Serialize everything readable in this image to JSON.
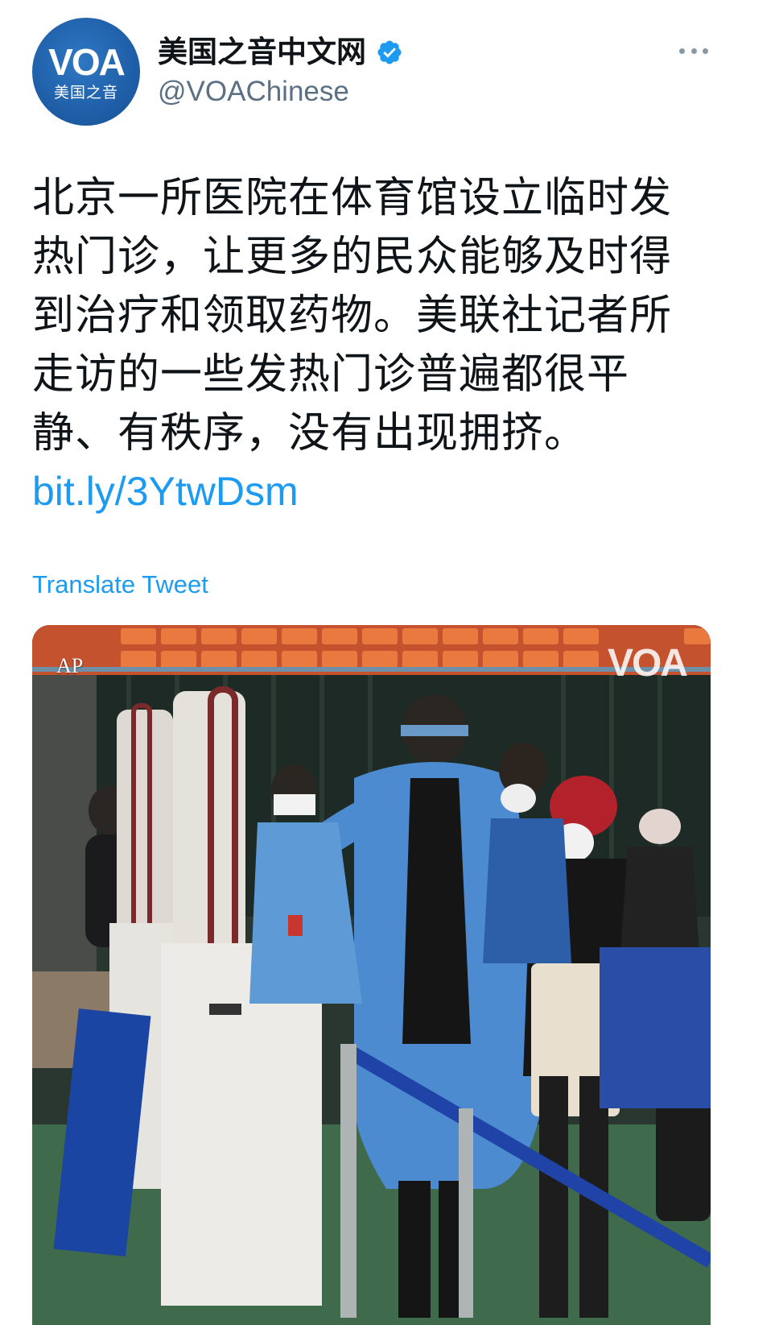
{
  "account": {
    "display_name": "美国之音中文网",
    "handle": "@VOAChinese",
    "avatar_logo": "VOA",
    "avatar_subtitle": "美国之音",
    "verified": true,
    "verified_icon": "verified-badge-icon",
    "more_icon": "more-options-icon"
  },
  "tweet": {
    "text": "北京一所医院在体育馆设立临时发热门诊，让更多的民众能够及时得到治疗和领取药物。美联社记者所走访的一些发热门诊普遍都很平静、有秩序，没有出现拥挤。",
    "link": "bit.ly/3YtwDsm",
    "translate_label": "Translate Tweet"
  },
  "media": {
    "credit": "AP",
    "watermark": "VOA"
  },
  "colors": {
    "link": "#1d9bf0",
    "verified": "#1d9bf0",
    "text": "#0f1419",
    "secondary": "#5b7083",
    "avatar_bg": "#1f5fa8"
  }
}
